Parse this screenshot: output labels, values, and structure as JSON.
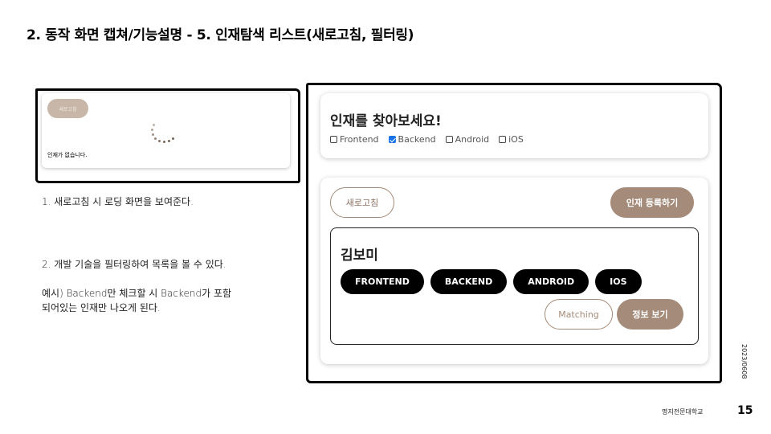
{
  "slide": {
    "title": "2. 동작 화면 캡쳐/기능설명 - 5. 인재탐색 리스트(새로고침, 필터링)",
    "date": "2023/0608",
    "school": "명지전문대학교",
    "page_number": "15"
  },
  "loading_preview": {
    "refresh_label": "새로고침",
    "empty_message": "인재가 없습니다.",
    "spinner_icon": "loading-spinner-icon"
  },
  "notes": {
    "note1": "1. 새로고침 시 로딩 화면을 보여준다.",
    "note2": "2. 개발 기술을 필터링하여 목록을 볼 수 있다.",
    "note3_line1": "예시) Backend만 체크할 시 Backend가 포함",
    "note3_line2": "되어있는 인재만 나오게 된다."
  },
  "search": {
    "title": "인재를 찾아보세요!",
    "filters": [
      {
        "label": "Frontend",
        "checked": false
      },
      {
        "label": "Backend",
        "checked": true
      },
      {
        "label": "Android",
        "checked": false
      },
      {
        "label": "iOS",
        "checked": false
      }
    ]
  },
  "list": {
    "refresh_label": "새로고침",
    "register_label": "인재 등록하기",
    "profile": {
      "name": "김보미",
      "tags": [
        "FRONTEND",
        "BACKEND",
        "ANDROID",
        "IOS"
      ],
      "matching_label": "Matching",
      "info_label": "정보 보기"
    }
  },
  "colors": {
    "accent": "#a48b7a",
    "checkbox_checked": "#1a73e8",
    "tag_background": "#000000"
  }
}
